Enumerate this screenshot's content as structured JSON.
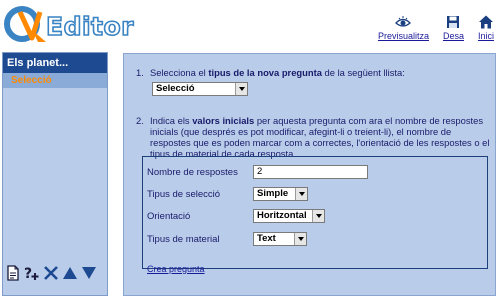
{
  "app": {
    "logo_text": "Editor"
  },
  "toplinks": [
    {
      "label": "Previsualitza",
      "icon": "eye-icon"
    },
    {
      "label": "Desa",
      "icon": "floppy-disk-icon"
    },
    {
      "label": "Inici",
      "icon": "home-icon"
    }
  ],
  "sidebar": {
    "title": "Els planet...",
    "selected": "Selecció",
    "tools": [
      "new-document-icon",
      "add-question-icon",
      "delete-icon",
      "move-up-icon",
      "move-down-icon"
    ]
  },
  "main": {
    "step1": {
      "num": "1.",
      "pre": "Selecciona el ",
      "bold": "tipus de la nova pregunta",
      "post": " de la següent llista:",
      "select_value": "Selecció"
    },
    "step2": {
      "num": "2.",
      "pre": "Indica els ",
      "bold": "valors inicials",
      "post": " per aquesta pregunta com ara el nombre de respostes inicials (que després es pot modificar, afegint-li o treient-li), el nombre de respostes que es poden marcar com a correctes, l'orientació de les respostes o el tipus de material de cada resposta."
    },
    "fields": {
      "responses_label": "Nombre de respostes",
      "responses_value": "2",
      "selection_label": "Tipus de selecció",
      "selection_value": "Simple",
      "orientation_label": "Orientació",
      "orientation_value": "Horitzontal",
      "material_label": "Tipus de material",
      "material_value": "Text"
    },
    "create_link": "Crea pregunta"
  },
  "colors": {
    "panel": "#b9cdea",
    "header_bar": "#1d4a91",
    "accent_orange": "#ff8a00",
    "logo_blue": "#3a84c4"
  }
}
